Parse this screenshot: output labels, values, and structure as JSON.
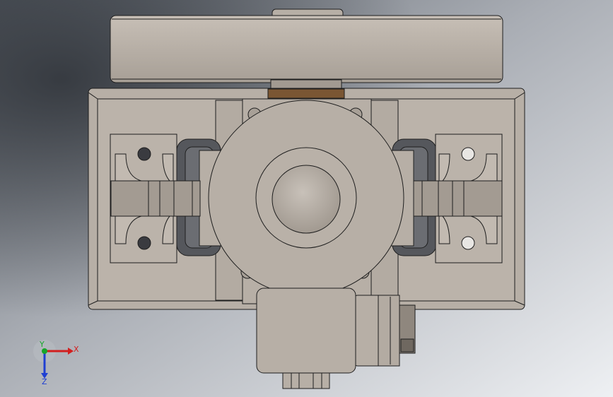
{
  "viewport": {
    "background_colors": [
      "#8f959c",
      "#e2e4e8"
    ],
    "part_fill": "#b7afa6",
    "part_fill_dark": "#9f968c",
    "part_shadow": "#55575c",
    "brown_accent": "#7a5633",
    "edge_color": "#1e1e1e"
  },
  "triad": {
    "x_label": "X",
    "y_label": "Y",
    "z_label": "Z",
    "x_color": "#d21f1f",
    "y_color": "#17a62a",
    "z_color": "#1f3fd2"
  }
}
